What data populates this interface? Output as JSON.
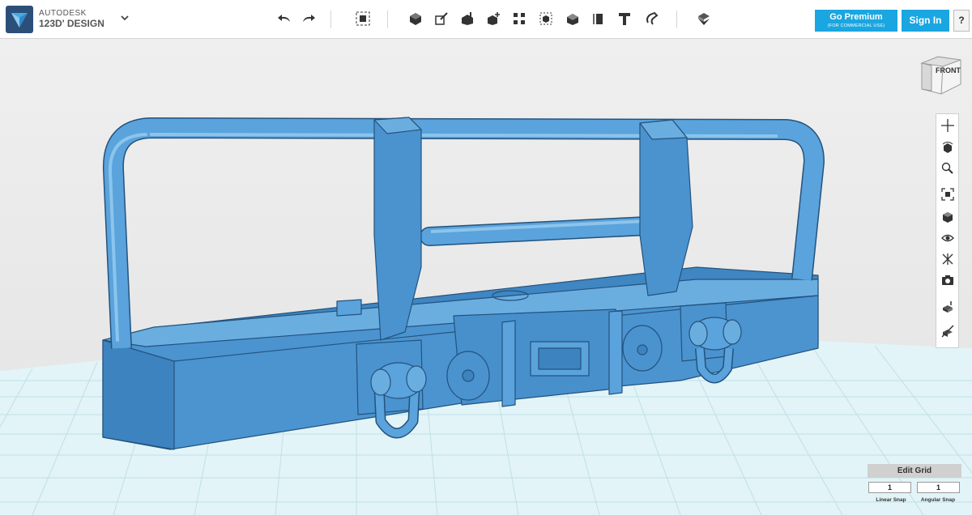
{
  "app": {
    "vendor": "AUTODESK",
    "product": "123D' DESIGN"
  },
  "toolbar": {
    "tools": [
      "undo-icon",
      "redo-icon",
      "select-icon",
      "primitives-icon",
      "sketch-icon",
      "construct-icon",
      "modify-icon",
      "pattern-icon",
      "grouping-icon",
      "combine-icon",
      "measure-icon",
      "text-icon",
      "snap-icon",
      "materials-icon"
    ]
  },
  "header": {
    "premium_label": "Go Premium",
    "premium_sub": "(FOR COMMERCIAL USE)",
    "signin_label": "Sign In",
    "help_label": "?"
  },
  "viewcube": {
    "face_label": "FRONT"
  },
  "navigation": {
    "tools": [
      "pan-icon",
      "orbit-icon",
      "zoom-icon",
      "fit-icon",
      "views-icon",
      "visibility-icon",
      "materials-outline-icon",
      "screenshot-icon",
      "snap-grid-icon",
      "hide-grid-icon"
    ]
  },
  "grid_panel": {
    "title": "Edit Grid",
    "linear_snap_value": "1",
    "linear_snap_label": "Linear Snap",
    "angular_snap_value": "1",
    "angular_snap_label": "Angular Snap"
  },
  "colors": {
    "model": "#4b94d0",
    "model_dark": "#2f6ea6",
    "accent": "#1aa6e0",
    "grid": "#bfe4ec"
  }
}
